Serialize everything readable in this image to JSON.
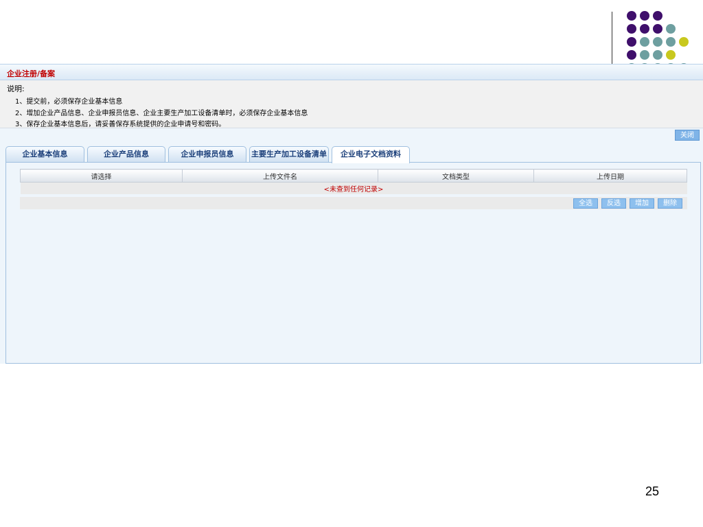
{
  "title": "企业注册/备案",
  "notes": {
    "heading": "说明:",
    "lines": [
      "1、提交前，必须保存企业基本信息",
      "2、增加企业产品信息、企业申报员信息、企业主要生产加工设备清单时，必须保存企业基本信息",
      "3、保存企业基本信息后，请妥善保存系统提供的企业申请号和密码。"
    ]
  },
  "close_label": "关闭",
  "tabs": [
    {
      "label": "企业基本信息"
    },
    {
      "label": "企业产品信息"
    },
    {
      "label": "企业申报员信息"
    },
    {
      "label": "主要生产加工设备清单"
    },
    {
      "label": "企业电子文档资料",
      "active": true
    }
  ],
  "table": {
    "columns": [
      "请选择",
      "上传文件名",
      "文档类型",
      "上传日期"
    ],
    "empty_message": "<未查到任何记录>"
  },
  "actions": {
    "select_all": "全选",
    "invert": "反选",
    "add": "增加",
    "delete": "删除"
  },
  "slide_number": "25",
  "colors": {
    "title": "#c00000",
    "accent_button": "#8ec0ee",
    "tab_text": "#1b3f7a",
    "dot_purple": "#3f0f6b",
    "dot_teal": "#6e9fa0",
    "dot_yellow": "#c8c81e"
  }
}
